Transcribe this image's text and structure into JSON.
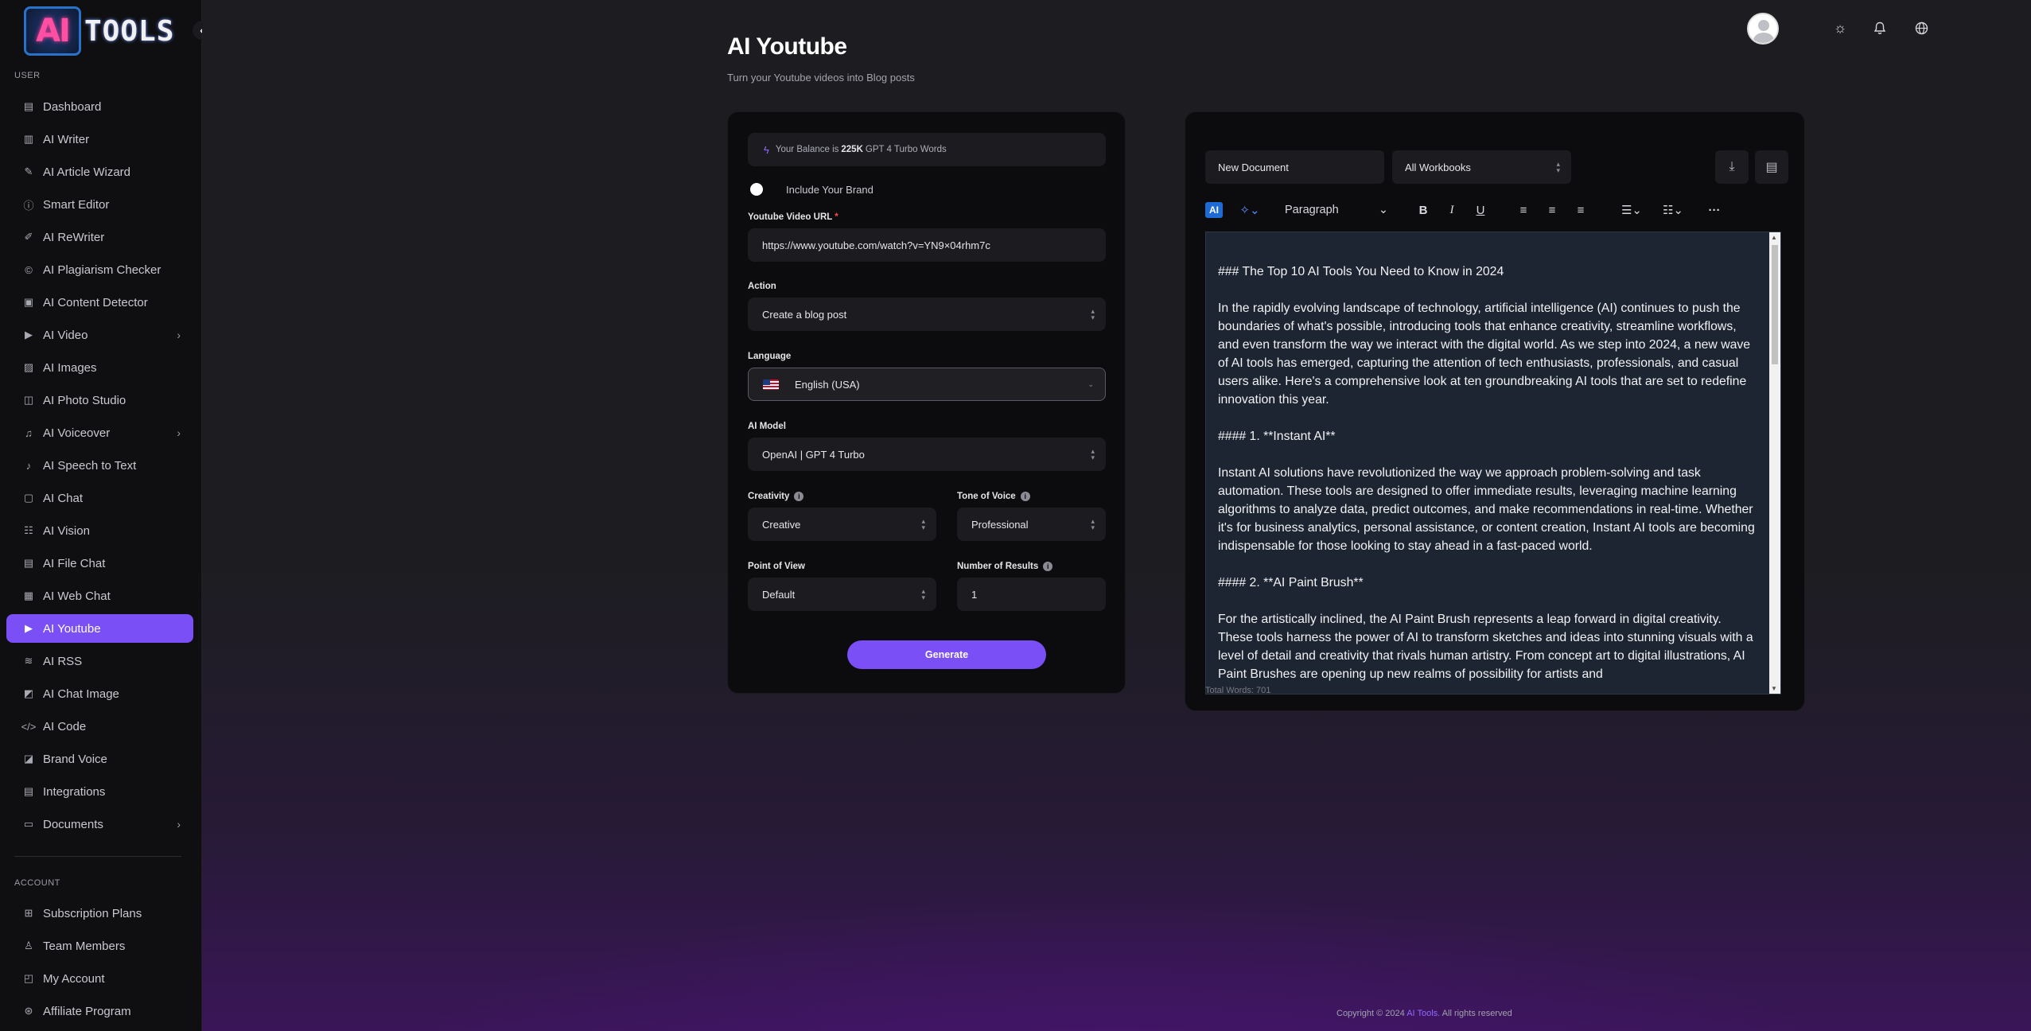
{
  "app": {
    "brand_letters": "AI",
    "brand_word": "TOOLS"
  },
  "sidebar": {
    "user_section": "USER",
    "items": [
      {
        "label": "Dashboard",
        "icon": "dashboard-icon",
        "glyph": "▤"
      },
      {
        "label": "AI Writer",
        "icon": "document-icon",
        "glyph": "▥"
      },
      {
        "label": "AI Article Wizard",
        "icon": "pen-icon",
        "glyph": "✎"
      },
      {
        "label": "Smart Editor",
        "icon": "info-circle-icon",
        "glyph": "ⓘ"
      },
      {
        "label": "AI ReWriter",
        "icon": "pencil-icon",
        "glyph": "✐"
      },
      {
        "label": "AI Plagiarism Checker",
        "icon": "copyright-icon",
        "glyph": "©"
      },
      {
        "label": "AI Content Detector",
        "icon": "scan-icon",
        "glyph": "▣"
      },
      {
        "label": "AI Video",
        "icon": "video-icon",
        "glyph": "▶",
        "chevron": true
      },
      {
        "label": "AI Images",
        "icon": "image-icon",
        "glyph": "▨"
      },
      {
        "label": "AI Photo Studio",
        "icon": "photo-icon",
        "glyph": "◫"
      },
      {
        "label": "AI Voiceover",
        "icon": "headphones-icon",
        "glyph": "♫",
        "chevron": true
      },
      {
        "label": "AI Speech to Text",
        "icon": "microphone-icon",
        "glyph": "♪"
      },
      {
        "label": "AI Chat",
        "icon": "chat-icon",
        "glyph": "▢"
      },
      {
        "label": "AI Vision",
        "icon": "sliders-icon",
        "glyph": "☷"
      },
      {
        "label": "AI File Chat",
        "icon": "file-chat-icon",
        "glyph": "▤"
      },
      {
        "label": "AI Web Chat",
        "icon": "web-chat-icon",
        "glyph": "▦"
      },
      {
        "label": "AI Youtube",
        "icon": "youtube-icon",
        "glyph": "▶",
        "active": true
      },
      {
        "label": "AI RSS",
        "icon": "rss-icon",
        "glyph": "≋"
      },
      {
        "label": "AI Chat Image",
        "icon": "chat-image-icon",
        "glyph": "◩"
      },
      {
        "label": "AI Code",
        "icon": "code-icon",
        "glyph": "</>"
      },
      {
        "label": "Brand Voice",
        "icon": "brand-icon",
        "glyph": "◪"
      },
      {
        "label": "Integrations",
        "icon": "integrations-icon",
        "glyph": "▤"
      },
      {
        "label": "Documents",
        "icon": "folder-icon",
        "glyph": "▭",
        "chevron": true
      }
    ],
    "account_section": "ACCOUNT",
    "account_items": [
      {
        "label": "Subscription Plans",
        "icon": "gift-icon",
        "glyph": "⊞"
      },
      {
        "label": "Team Members",
        "icon": "team-icon",
        "glyph": "♙"
      },
      {
        "label": "My Account",
        "icon": "account-icon",
        "glyph": "◰"
      },
      {
        "label": "Affiliate Program",
        "icon": "affiliate-icon",
        "glyph": "⊛"
      }
    ]
  },
  "header": {
    "title": "AI Youtube",
    "subtitle": "Turn your Youtube videos into Blog posts"
  },
  "form": {
    "balance_prefix": "Your Balance is",
    "balance_value": "225K",
    "balance_suffix": "GPT 4 Turbo Words",
    "brand_toggle_label": "Include Your Brand",
    "url_label": "Youtube Video URL",
    "url_value": "https://www.youtube.com/watch?v=YN9×04rhm7c",
    "action_label": "Action",
    "action_value": "Create a blog post",
    "language_label": "Language",
    "language_value": "English (USA)",
    "model_label": "AI Model",
    "model_value": "OpenAI | GPT 4 Turbo",
    "creativity_label": "Creativity",
    "creativity_value": "Creative",
    "tone_label": "Tone of Voice",
    "tone_value": "Professional",
    "pov_label": "Point of View",
    "pov_value": "Default",
    "results_label": "Number of Results",
    "results_value": "1",
    "generate_label": "Generate"
  },
  "editor": {
    "doc_title": "New Document",
    "workbook": "All Workbooks",
    "paragraph_style": "Paragraph",
    "ai_label": "AI",
    "content": [
      "### The Top 10 AI Tools You Need to Know in 2024",
      "In the rapidly evolving landscape of technology, artificial intelligence (AI) continues to push the boundaries of what's possible, introducing tools that enhance creativity, streamline workflows, and even transform the way we interact with the digital world. As we step into 2024, a new wave of AI tools has emerged, capturing the attention of tech enthusiasts, professionals, and casual users alike. Here's a comprehensive look at ten groundbreaking AI tools that are set to redefine innovation this year.",
      "#### 1. **Instant AI**",
      "Instant AI solutions have revolutionized the way we approach problem-solving and task automation. These tools are designed to offer immediate results, leveraging machine learning algorithms to analyze data, predict outcomes, and make recommendations in real-time. Whether it's for business analytics, personal assistance, or content creation, Instant AI tools are becoming indispensable for those looking to stay ahead in a fast-paced world.",
      "#### 2. **AI Paint Brush**",
      "For the artistically inclined, the AI Paint Brush represents a leap forward in digital creativity. These tools harness the power of AI to transform sketches and ideas into stunning visuals with a level of detail and creativity that rivals human artistry. From concept art to digital illustrations, AI Paint Brushes are opening up new realms of possibility for artists and"
    ],
    "word_count": "Total Words: 701"
  },
  "footer": {
    "prefix": "Copyright © 2024",
    "brand": "AI Tools.",
    "suffix": "All rights reserved"
  },
  "colors": {
    "accent": "#7a4ff5",
    "editor_bg": "#1c2531",
    "card_bg": "#0c0c0e"
  }
}
